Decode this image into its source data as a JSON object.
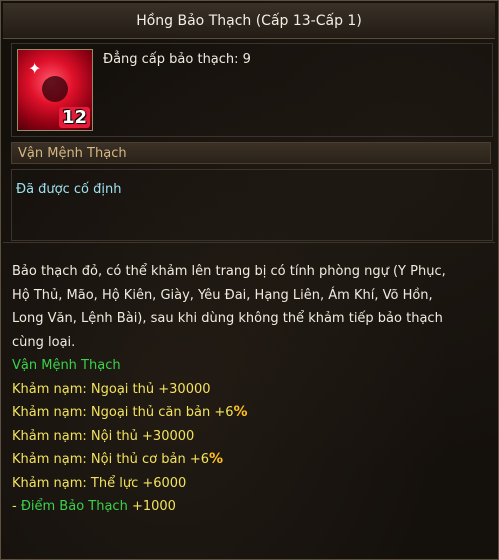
{
  "title": "Hồng Bảo Thạch (Cấp 13-Cấp 1)",
  "item": {
    "icon": "red-gem-icon",
    "badge": "12",
    "level_text": "Đẳng cấp bảo thạch: 9"
  },
  "section_label": "Vận Mệnh Thạch",
  "fixed_status": "Đã được cố định",
  "description": [
    "Bảo thạch đỏ, có thể khảm lên trang bị có tính phòng ngự (Y Phục,",
    "Hộ Thủ, Mão, Hộ Kiên, Giày, Yêu Đai, Hạng Liên, Ám Khí, Võ Hồn,",
    "Long Văn, Lệnh Bài), sau khi dùng không thể khảm tiếp bảo thạch",
    "cùng loại."
  ],
  "set_name": "Vận Mệnh Thạch",
  "stats": [
    "Khảm nạm: Ngoại thủ +30000",
    "Khảm nạm: Ngoại thủ căn bản +6",
    "Khảm nạm: Nội thủ +30000",
    "Khảm nạm: Nội thủ cơ bản +6",
    "Khảm nạm: Thể lực +6000"
  ],
  "percent_sign": "%",
  "bonus": {
    "prefix": "- ",
    "label": "Điểm Bảo Thạch",
    "value": " +1000"
  },
  "colors": {
    "set_name": "#3ad24a",
    "stat_text": "#f2e25c",
    "percent": "#ffc020",
    "fixed_status": "#9fe0ef",
    "section_label": "#d6b784"
  }
}
